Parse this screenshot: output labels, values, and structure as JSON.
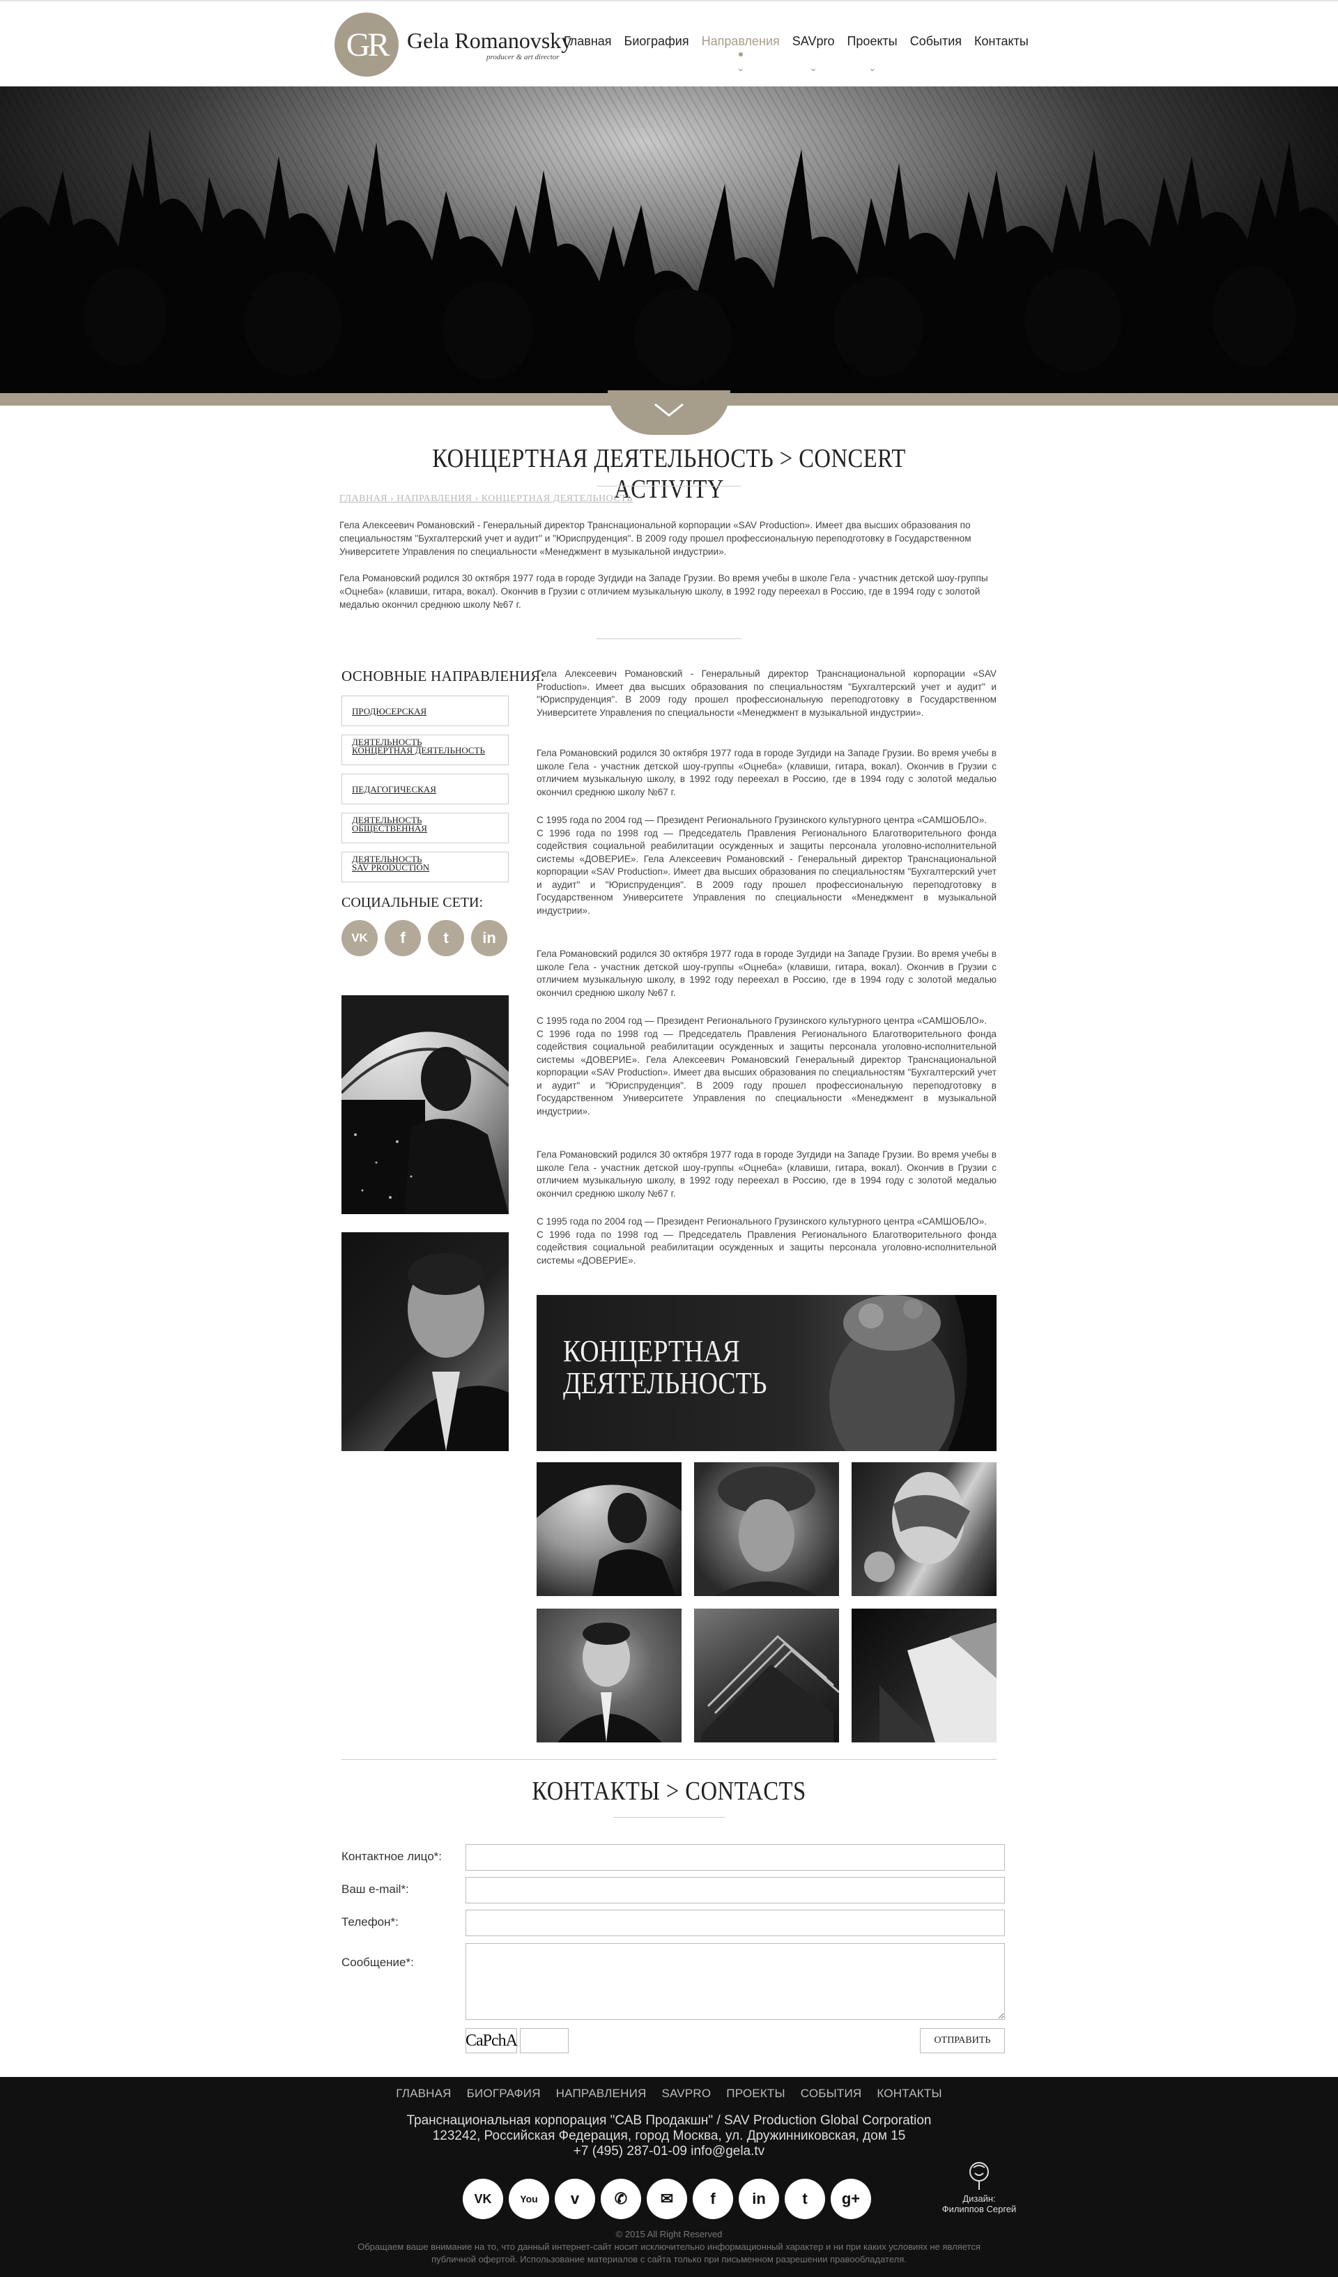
{
  "header": {
    "logo_monogram": "GR",
    "logo_name": "Gela Romanovsky",
    "logo_subtitle": "producer & art director",
    "nav": [
      {
        "label": "Главная"
      },
      {
        "label": "Биография"
      },
      {
        "label": "Направления"
      },
      {
        "label": "SAVpro"
      },
      {
        "label": "Проекты"
      },
      {
        "label": "События"
      },
      {
        "label": "Контакты"
      }
    ],
    "active_nav": "Направления",
    "accent_color": "#a79d8b"
  },
  "page": {
    "title": "КОНЦЕРТНАЯ ДЕЯТЕЛЬНОСТЬ > CONCERT ACTIVITY",
    "breadcrumb": "ГЛАВНАЯ › НАПРАВЛЕНИЯ › КОНЦЕРТНАЯ ДЕЯТЕЛЬНОСТЬ",
    "intro": [
      "Гела Алексеевич Романовский - Генеральный директор Транснациональной корпорации «SAV Production». Имеет два высших образования по специальностям \"Бухгалтерский учет и аудит\" и \"Юриспруденция\". В 2009 году прошел профессиональную переподготовку в Государственном Университете Управления по специальности «Менеджмент в музыкальной индустрии».",
      "Гела Романовский родился 30 октября 1977 года в городе Зугдиди на Западе Грузии. Во время учебы в школе Гела - участник детской шоу-группы «Оцнеба» (клавиши, гитара, вокал). Окончив в Грузии с отличием музыкальную школу, в 1992 году переехал в Россию, где в 1994 году с золотой медалью окончил среднюю школу №67 г."
    ]
  },
  "sidebar": {
    "heading": "ОСНОВНЫЕ НАПРАВЛЕНИЯ:",
    "items": [
      {
        "label": "ПРОДЮСЕРСКАЯ ДЕЯТЕЛЬНОСТЬ"
      },
      {
        "label": "КОНЦЕРТНАЯ ДЕЯТЕЛЬНОСТЬ"
      },
      {
        "label": "ПЕДАГОГИЧЕСКАЯ ДЕЯТЕЛЬНОСТЬ"
      },
      {
        "label": "ОБЩЕСТВЕННАЯ ДЕЯТЕЛЬНОСТЬ"
      },
      {
        "label": "SAV PRODUCTION"
      }
    ],
    "social_heading": "СОЦИАЛЬНЫЕ СЕТИ:",
    "social": [
      {
        "icon": "vk-icon",
        "glyph": "VK"
      },
      {
        "icon": "facebook-icon",
        "glyph": "f"
      },
      {
        "icon": "twitter-icon",
        "glyph": "t"
      },
      {
        "icon": "linkedin-icon",
        "glyph": "in"
      }
    ]
  },
  "main": {
    "paragraphs": [
      "Гела Алексеевич Романовский - Генеральный директор Транснациональной корпорации «SAV Production». Имеет два высших образования по специальностям \"Бухгалтерский учет и аудит\" и \"Юриспруденция\". В 2009 году прошел профессиональную переподготовку в Государственном Университете Управления по специальности «Менеджмент в музыкальной индустрии».",
      "Гела Романовский родился 30 октября 1977 года в городе Зугдиди на Западе Грузии. Во время учебы в школе Гела - участник детской шоу-группы «Оцнеба» (клавиши, гитара, вокал). Окончив в Грузии с отличием музыкальную школу, в 1992 году переехал в Россию, где в 1994 году с золотой медалью окончил среднюю школу №67 г.",
      "С 1995 года по 2004 год — Президент Регионального Грузинского культурного центра «САМШОБЛО».\nС 1996 года по 1998 год — Председатель Правления Регионального Благотворительного фонда содействия социальной реабилитации осужденных и защиты персонала уголовно-исполнительной системы «ДОВЕРИЕ». Гела Алексеевич Романовский - Генеральный директор Транснациональной корпорации «SAV Production». Имеет два высших образования по специальностям \"Бухгалтерский учет и аудит\" и \"Юриспруденция\". В 2009 году прошел профессиональную переподготовку в Государственном Университете Управления по специальности «Менеджмент в музыкальной индустрии».",
      "Гела Романовский родился 30 октября 1977 года в городе Зугдиди на Западе Грузии. Во время учебы в школе Гела - участник детской шоу-группы «Оцнеба» (клавиши, гитара, вокал). Окончив в Грузии с отличием музыкальную школу, в 1992 году переехал в Россию, где в 1994 году с золотой медалью окончил среднюю школу №67 г.",
      "С 1995 года по 2004 год — Президент Регионального Грузинского культурного центра «САМШОБЛО».\nС 1996 года по 1998 год — Председатель Правления Регионального Благотворительного фонда содействия социальной реабилитации осужденных и защиты персонала уголовно-исполнительной системы «ДОВЕРИЕ». Гела Алексеевич Романовский Генеральный директор Транснациональной корпорации «SAV Production». Имеет два высших образования по специальностям \"Бухгалтерский учет и аудит\" и \"Юриспруденция\". В 2009 году прошел профессиональную переподготовку в Государственном Университете Управления по специальности «Менеджмент в музыкальной индустрии».",
      "Гела Романовский родился 30 октября 1977 года в городе Зугдиди на Западе Грузии. Во время учебы в школе Гела - участник детской шоу-группы «Оцнеба» (клавиши, гитара, вокал). Окончив в Грузии с отличием музыкальную школу, в 1992 году переехал в Россию, где в 1994 году с золотой медалью окончил среднюю школу №67 г.",
      "С 1995 года по 2004 год — Президент Регионального Грузинского культурного центра «САМШОБЛО».\nС 1996 года по 1998 год — Председатель Правления Регионального Благотворительного фонда содействия социальной реабилитации осужденных и защиты персонала уголовно-исполнительной системы «ДОВЕРИЕ»."
    ],
    "banner_title": "КОНЦЕРТНАЯ\nДЕЯТЕЛЬНОСТЬ"
  },
  "contacts": {
    "title": "КОНТАКТЫ > CONTACTS",
    "fields": [
      {
        "label": "Контактное лицо*:"
      },
      {
        "label": "Ваш e-mail*:"
      },
      {
        "label": "Телефон*:"
      },
      {
        "label": "Сообщение*:"
      }
    ],
    "captcha": "CaPchA",
    "submit": "ОТПРАВИТЬ"
  },
  "footer": {
    "nav": [
      {
        "label": "ГЛАВНАЯ"
      },
      {
        "label": "БИОГРАФИЯ"
      },
      {
        "label": "НАПРАВЛЕНИЯ"
      },
      {
        "label": "SAVPRO"
      },
      {
        "label": "ПРОЕКТЫ"
      },
      {
        "label": "СОБЫТИЯ"
      },
      {
        "label": "КОНТАКТЫ"
      }
    ],
    "company": "Транснациональная корпорация \"САВ Продакшн\" / SAV Production Global Corporation",
    "address": "123242, Российская Федерация, город Москва, ул. Дружинниковская, дом 15",
    "contacts": "+7 (495) 287-01-09 info@gela.tv",
    "social": [
      {
        "icon": "vk-icon",
        "glyph": "VK"
      },
      {
        "icon": "youtube-icon",
        "glyph": "You"
      },
      {
        "icon": "vimeo-icon",
        "glyph": "v"
      },
      {
        "icon": "phone-icon",
        "glyph": "✆"
      },
      {
        "icon": "mail-icon",
        "glyph": "✉"
      },
      {
        "icon": "facebook-icon",
        "glyph": "f"
      },
      {
        "icon": "linkedin-icon",
        "glyph": "in"
      },
      {
        "icon": "twitter-icon",
        "glyph": "t"
      },
      {
        "icon": "google-plus-icon",
        "glyph": "g+"
      }
    ],
    "design_label": "Дизайн:",
    "design_name": "Филиппов Сергей",
    "copyright": "© 2015 All Right Reserved",
    "disclaimer_1": "Обращаем ваше внимание на то, что данный интернет-сайт носит исключительно информационный характер и ни при каких условиях не является",
    "disclaimer_2": "публичной офертой. Использование материалов с сайта только при письменном разрешении правообладателя."
  }
}
